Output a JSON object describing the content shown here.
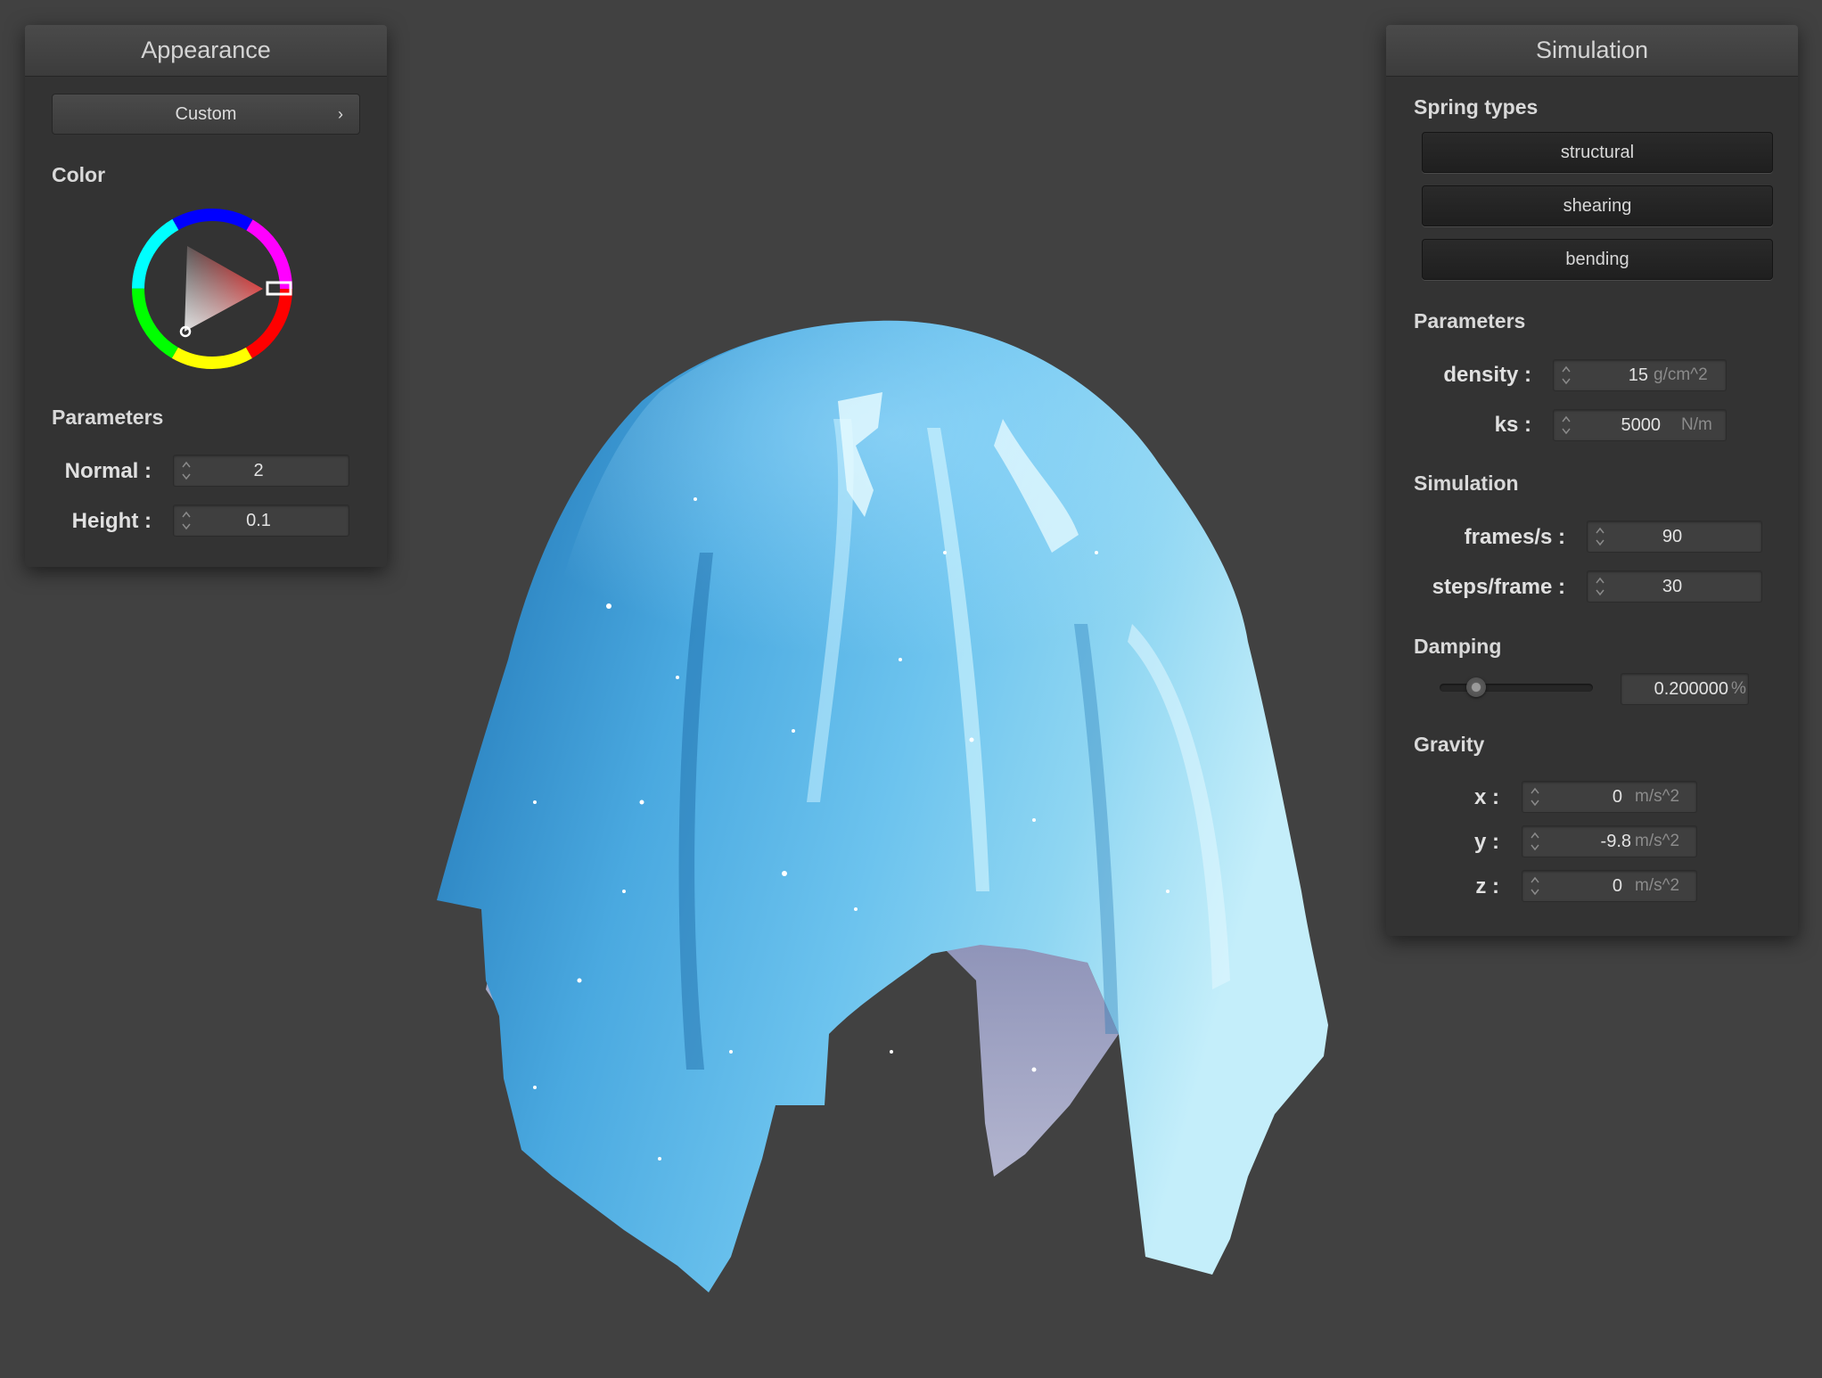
{
  "appearance": {
    "title": "Appearance",
    "preset_button": "Custom",
    "chevron": "›",
    "color_label": "Color",
    "parameters_label": "Parameters",
    "normal": {
      "label": "Normal :",
      "value": "2"
    },
    "height": {
      "label": "Height :",
      "value": "0.1"
    },
    "selected_color": "#cc2222"
  },
  "simulation": {
    "title": "Simulation",
    "spring_types_label": "Spring types",
    "springs": [
      "structural",
      "shearing",
      "bending"
    ],
    "parameters_label": "Parameters",
    "density": {
      "label": "density :",
      "value": "15",
      "unit": "g/cm^2"
    },
    "ks": {
      "label": "ks :",
      "value": "5000",
      "unit": "N/m"
    },
    "simulation_label": "Simulation",
    "fps": {
      "label": "frames/s :",
      "value": "90"
    },
    "steps": {
      "label": "steps/frame :",
      "value": "30"
    },
    "damping_label": "Damping",
    "damping": {
      "value": "0.200000",
      "unit": "%",
      "slider_fraction": 0.2
    },
    "gravity_label": "Gravity",
    "gravity": [
      {
        "label": "x :",
        "value": "0",
        "unit": "m/s^2"
      },
      {
        "label": "y :",
        "value": "-9.8",
        "unit": "m/s^2"
      },
      {
        "label": "z :",
        "value": "0",
        "unit": "m/s^2"
      }
    ]
  },
  "colors": {
    "background": "#414141",
    "panel": "#333333",
    "cloth": "#3f9fd6"
  }
}
